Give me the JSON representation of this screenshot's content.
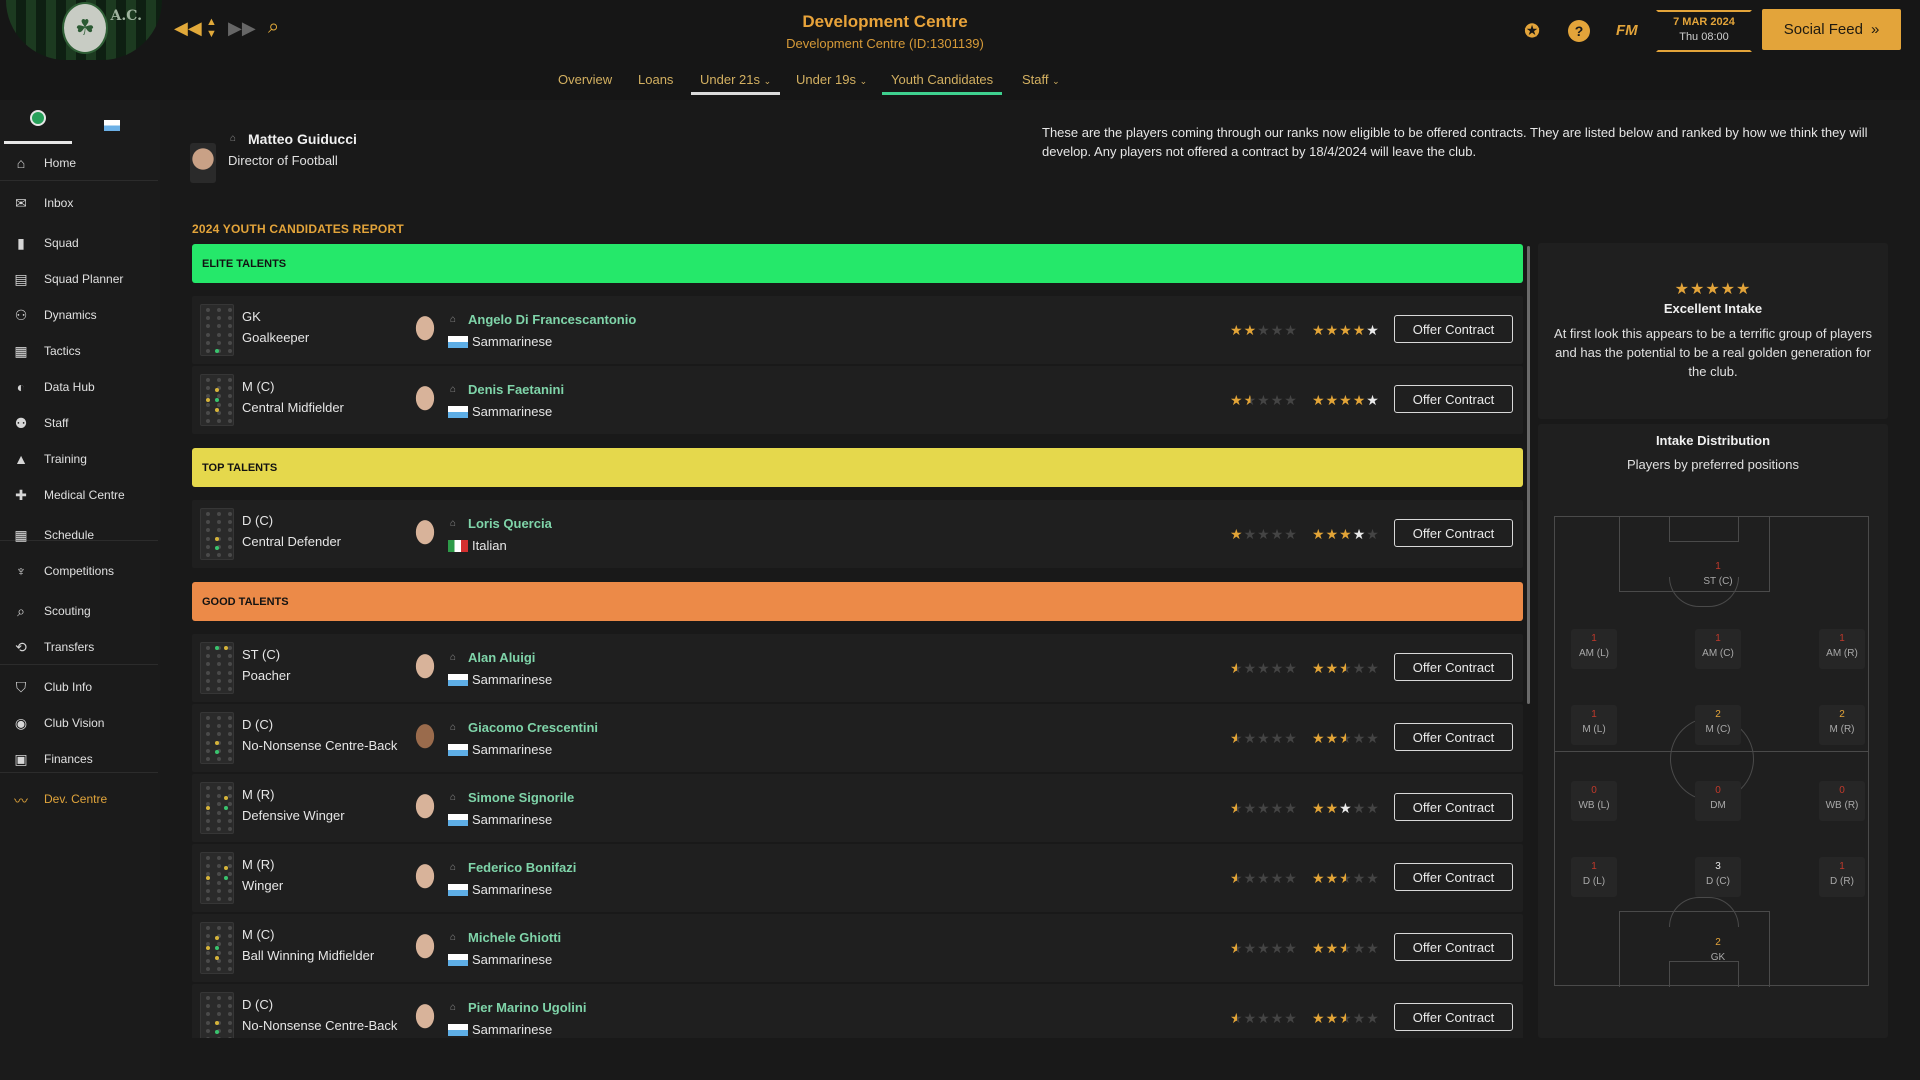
{
  "header": {
    "title": "Development Centre",
    "subtitle": "Development Centre (ID:1301139)",
    "club_badge_text": "A.C.",
    "fm_label": "FM",
    "date": "7 MAR 2024",
    "time": "Thu 08:00",
    "social_feed_label": "Social Feed"
  },
  "tabs": [
    {
      "label": "Overview"
    },
    {
      "label": "Loans"
    },
    {
      "label": "Under 21s"
    },
    {
      "label": "Under 19s"
    },
    {
      "label": "Youth Candidates"
    },
    {
      "label": "Staff"
    }
  ],
  "sidebar": {
    "items": [
      {
        "label": "Home",
        "icon": "home-icon"
      },
      {
        "label": "Inbox",
        "icon": "inbox-icon"
      },
      {
        "label": "Squad",
        "icon": "shirt-icon"
      },
      {
        "label": "Squad Planner",
        "icon": "clipboard-icon"
      },
      {
        "label": "Dynamics",
        "icon": "people-icon"
      },
      {
        "label": "Tactics",
        "icon": "tactics-icon"
      },
      {
        "label": "Data Hub",
        "icon": "data-icon"
      },
      {
        "label": "Staff",
        "icon": "staff-icon"
      },
      {
        "label": "Training",
        "icon": "training-icon"
      },
      {
        "label": "Medical Centre",
        "icon": "medical-icon"
      },
      {
        "label": "Schedule",
        "icon": "calendar-icon"
      },
      {
        "label": "Competitions",
        "icon": "trophy-icon"
      },
      {
        "label": "Scouting",
        "icon": "scouting-icon"
      },
      {
        "label": "Transfers",
        "icon": "transfers-icon"
      },
      {
        "label": "Club Info",
        "icon": "shield-icon"
      },
      {
        "label": "Club Vision",
        "icon": "vision-icon"
      },
      {
        "label": "Finances",
        "icon": "finances-icon"
      },
      {
        "label": "Dev. Centre",
        "icon": "dev-centre-icon"
      }
    ]
  },
  "director": {
    "name": "Matteo Guiducci",
    "role": "Director of Football"
  },
  "intro_text": "These are the players coming through our ranks now eligible to be offered contracts. They are listed below and ranked by how we think they will develop. Any players not offered a contract by 18/4/2024 will leave the club.",
  "report_title": "2024 YOUTH CANDIDATES REPORT",
  "groups": [
    {
      "label": "ELITE TALENTS",
      "color": "#25e86a"
    },
    {
      "label": "TOP TALENTS",
      "color": "#e5d84c"
    },
    {
      "label": "GOOD TALENTS",
      "color": "#ec8a48"
    }
  ],
  "offer_label": "Offer Contract",
  "players": [
    {
      "position": "GK",
      "role": "Goalkeeper",
      "name": "Angelo Di Francescantonio",
      "nationality": "Sammarinese",
      "current_ability": 2,
      "potential_ability": 5
    },
    {
      "position": "M (C)",
      "role": "Central Midfielder",
      "name": "Denis Faetanini",
      "nationality": "Sammarinese",
      "current_ability": 1.5,
      "potential_ability": 5
    },
    {
      "position": "D (C)",
      "role": "Central Defender",
      "name": "Loris Quercia",
      "nationality": "Italian",
      "current_ability": 1,
      "potential_ability": 4
    },
    {
      "position": "ST (C)",
      "role": "Poacher",
      "name": "Alan Aluigi",
      "nationality": "Sammarinese",
      "current_ability": 0.5,
      "potential_ability": 2.5
    },
    {
      "position": "D (C)",
      "role": "No-Nonsense Centre-Back",
      "name": "Giacomo Crescentini",
      "nationality": "Sammarinese",
      "current_ability": 0.5,
      "potential_ability": 2.5
    },
    {
      "position": "M (R)",
      "role": "Defensive Winger",
      "name": "Simone Signorile",
      "nationality": "Sammarinese",
      "current_ability": 0.5,
      "potential_ability": 3
    },
    {
      "position": "M (R)",
      "role": "Winger",
      "name": "Federico Bonifazi",
      "nationality": "Sammarinese",
      "current_ability": 0.5,
      "potential_ability": 2.5
    },
    {
      "position": "M (C)",
      "role": "Ball Winning Midfielder",
      "name": "Michele Ghiotti",
      "nationality": "Sammarinese",
      "current_ability": 0.5,
      "potential_ability": 2.5
    },
    {
      "position": "D (C)",
      "role": "No-Nonsense Centre-Back",
      "name": "Pier Marino Ugolini",
      "nationality": "Sammarinese",
      "current_ability": 0.5,
      "potential_ability": 2.5
    }
  ],
  "intake": {
    "rating_stars": 5,
    "title": "Excellent Intake",
    "description": "At first look this appears to be a terrific group of players and has the potential to be a real golden generation for the club."
  },
  "distribution": {
    "title": "Intake Distribution",
    "subtitle": "Players by preferred positions",
    "positions": [
      {
        "label": "ST (C)",
        "count": "1"
      },
      {
        "label": "AM (L)",
        "count": "1"
      },
      {
        "label": "AM (C)",
        "count": "1"
      },
      {
        "label": "AM (R)",
        "count": "1"
      },
      {
        "label": "M (L)",
        "count": "1"
      },
      {
        "label": "M (C)",
        "count": "2"
      },
      {
        "label": "M (R)",
        "count": "2"
      },
      {
        "label": "WB (L)",
        "count": "0"
      },
      {
        "label": "DM",
        "count": "0"
      },
      {
        "label": "WB (R)",
        "count": "0"
      },
      {
        "label": "D (L)",
        "count": "1"
      },
      {
        "label": "D (C)",
        "count": "3"
      },
      {
        "label": "D (R)",
        "count": "1"
      },
      {
        "label": "GK",
        "count": "2"
      }
    ]
  }
}
